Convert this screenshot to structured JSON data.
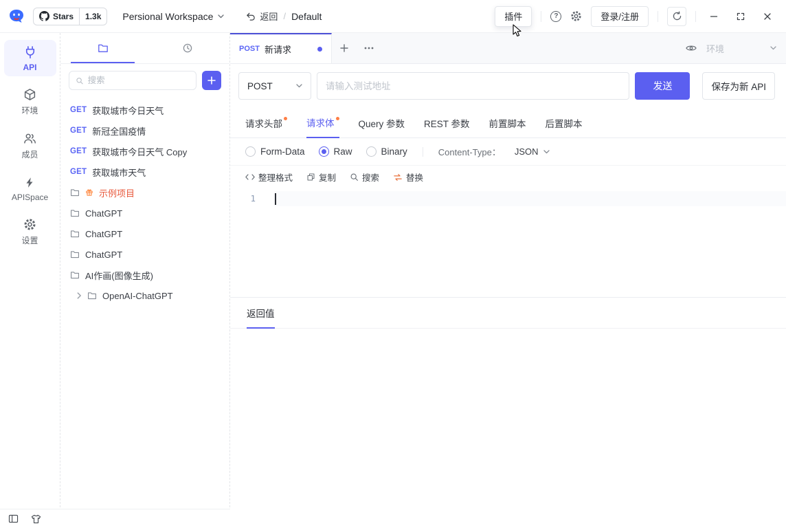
{
  "colors": {
    "accent": "#5b5ff0",
    "orange_dot": "#ff7e45",
    "sample_folder_text": "#e8593c",
    "method_get": "#5b66f5"
  },
  "header": {
    "stars_label": "Stars",
    "stars_count": "1.3k",
    "workspace_label": "Persional Workspace",
    "back_label": "返回",
    "breadcrumb_sep": "/",
    "project_label": "Default",
    "plugin_label": "插件",
    "help_label": "?",
    "login_label": "登录/注册"
  },
  "rail": {
    "items": [
      {
        "label": "API"
      },
      {
        "label": "环境"
      },
      {
        "label": "成员"
      },
      {
        "label": "APISpace"
      },
      {
        "label": "设置"
      }
    ]
  },
  "sidebar": {
    "search_placeholder": "搜索",
    "apis": [
      {
        "method": "GET",
        "name": "获取城市今日天气"
      },
      {
        "method": "GET",
        "name": "新冠全国疫情"
      },
      {
        "method": "GET",
        "name": "获取城市今日天气 Copy"
      },
      {
        "method": "GET",
        "name": "获取城市天气"
      }
    ],
    "folders": [
      {
        "name": "示例项目"
      },
      {
        "name": "ChatGPT"
      },
      {
        "name": "ChatGPT"
      },
      {
        "name": "ChatGPT"
      },
      {
        "name": "AI作画(图像生成)"
      },
      {
        "name": "OpenAI-ChatGPT"
      }
    ]
  },
  "main": {
    "tab_method": "POST",
    "tab_title": "新请求",
    "env_label": "环境",
    "method_value": "POST",
    "url_placeholder": "请输入测试地址",
    "send_label": "发送",
    "save_label": "保存为新 API",
    "config_tabs": [
      {
        "label": "请求头部"
      },
      {
        "label": "请求体"
      },
      {
        "label": "Query 参数"
      },
      {
        "label": "REST 参数"
      },
      {
        "label": "前置脚本"
      },
      {
        "label": "后置脚本"
      }
    ],
    "body_types": [
      {
        "label": "Form-Data"
      },
      {
        "label": "Raw"
      },
      {
        "label": "Binary"
      }
    ],
    "content_type_label": "Content-Type：",
    "content_type_value": "JSON",
    "toolbar": [
      {
        "label": "整理格式"
      },
      {
        "label": "复制"
      },
      {
        "label": "搜索"
      },
      {
        "label": "替换"
      }
    ],
    "line_number": "1",
    "response_tab": "返回值"
  }
}
